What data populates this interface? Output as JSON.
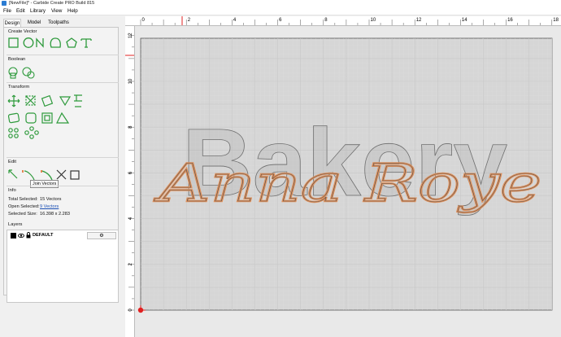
{
  "window": {
    "title": "[NewFile]* - Carbide Create PRO Build 815"
  },
  "menu": [
    "File",
    "Edit",
    "Library",
    "View",
    "Help"
  ],
  "tabs": [
    "Design",
    "Model",
    "Toolpaths"
  ],
  "sections": {
    "create_vector": "Create Vector",
    "boolean": "Boolean",
    "transform": "Transform",
    "edit": "Edit",
    "info": "Info",
    "layers": "Layers"
  },
  "tooltip": "Join Vectors",
  "info": {
    "total_selected_label": "Total Selected:",
    "total_selected_value": "15 Vectors",
    "open_selected_label": "Open Selected:",
    "open_selected_value": "9 Vectors",
    "selected_size_label": "Selected Size:",
    "selected_size_value": "16.398 x 2.283"
  },
  "layers": [
    {
      "name": "DEFAULT"
    }
  ],
  "ruler": {
    "x_labels": [
      "0",
      "2",
      "4",
      "6",
      "8",
      "10",
      "12",
      "14",
      "16",
      "18"
    ],
    "y_labels": [
      "12",
      "10",
      "8",
      "6",
      "4",
      "2",
      "0"
    ]
  },
  "canvas": {
    "text_block": "Bakery",
    "text_script": "Anna Roye",
    "script_color": "#e0905a",
    "block_color": "#8c8c8c",
    "grid_color": "#c8c8c8"
  },
  "colors": {
    "accent_green": "#2e9a3c",
    "ruler_red": "#e02020"
  }
}
